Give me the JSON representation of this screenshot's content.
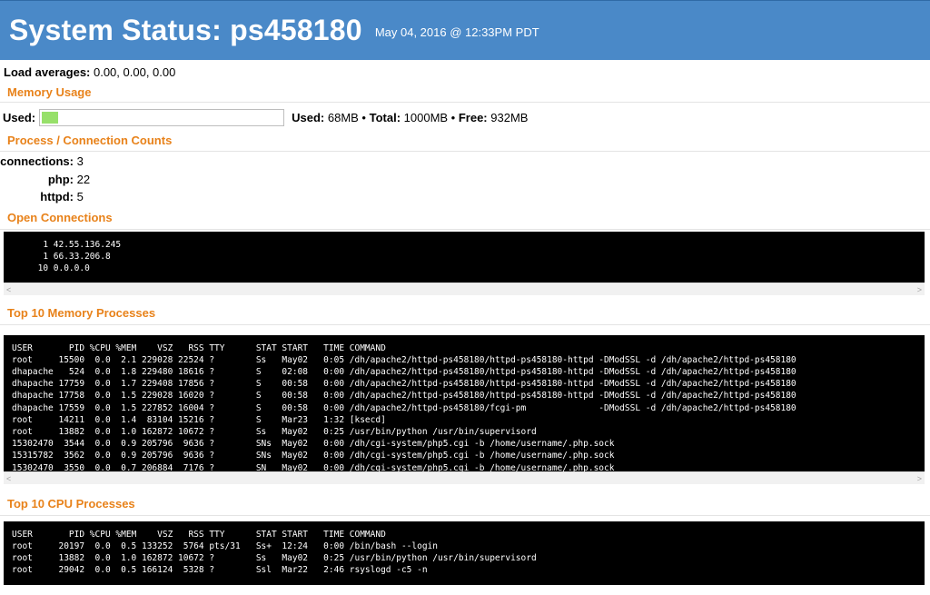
{
  "header": {
    "title": "System Status: ps458180",
    "date": "May 04, 2016 @ 12:33PM PDT"
  },
  "load": {
    "label": "Load averages:",
    "value": " 0.00, 0.00, 0.00"
  },
  "memory": {
    "heading": "Memory Usage",
    "used_label": "Used:",
    "used_fraction": 0.068,
    "summary_used_label": "Used:",
    "summary_used_value": " 68MB • ",
    "summary_total_label": "Total:",
    "summary_total_value": " 1000MB • ",
    "summary_free_label": "Free:",
    "summary_free_value": " 932MB",
    "bar_color": "#97e06a"
  },
  "counts": {
    "heading": "Process / Connection Counts",
    "items": [
      {
        "label": "connections:",
        "value": " 3"
      },
      {
        "label": "php:",
        "value": " 22"
      },
      {
        "label": "httpd:",
        "value": " 5"
      }
    ]
  },
  "connections": {
    "heading": "Open Connections",
    "text": "      1 42.55.136.245\n      1 66.33.206.8\n     10 0.0.0.0"
  },
  "mem_procs": {
    "heading": "Top 10 Memory Processes",
    "text": "USER       PID %CPU %MEM    VSZ   RSS TTY      STAT START   TIME COMMAND\nroot     15500  0.0  2.1 229028 22524 ?        Ss   May02   0:05 /dh/apache2/httpd-ps458180/httpd-ps458180-httpd -DModSSL -d /dh/apache2/httpd-ps458180\ndhapache   524  0.0  1.8 229480 18616 ?        S    02:08   0:00 /dh/apache2/httpd-ps458180/httpd-ps458180-httpd -DModSSL -d /dh/apache2/httpd-ps458180\ndhapache 17759  0.0  1.7 229408 17856 ?        S    00:58   0:00 /dh/apache2/httpd-ps458180/httpd-ps458180-httpd -DModSSL -d /dh/apache2/httpd-ps458180\ndhapache 17758  0.0  1.5 229028 16020 ?        S    00:58   0:00 /dh/apache2/httpd-ps458180/httpd-ps458180-httpd -DModSSL -d /dh/apache2/httpd-ps458180\ndhapache 17559  0.0  1.5 227852 16004 ?        S    00:58   0:00 /dh/apache2/httpd-ps458180/fcgi-pm              -DModSSL -d /dh/apache2/httpd-ps458180\nroot     14211  0.0  1.4  83104 15216 ?        S    Mar23   1:32 [ksecd]\nroot     13882  0.0  1.0 162872 10672 ?        Ss   May02   0:25 /usr/bin/python /usr/bin/supervisord\n15302470  3544  0.0  0.9 205796  9636 ?        SNs  May02   0:00 /dh/cgi-system/php5.cgi -b /home/username/.php.sock\n15315782  3562  0.0  0.9 205796  9636 ?        SNs  May02   0:00 /dh/cgi-system/php5.cgi -b /home/username/.php.sock\n15302470  3550  0.0  0.7 206884  7176 ?        SN   May02   0:00 /dh/cgi-system/php5.cgi -b /home/username/.php.sock"
  },
  "cpu_procs": {
    "heading": "Top 10 CPU Processes",
    "text": "USER       PID %CPU %MEM    VSZ   RSS TTY      STAT START   TIME COMMAND\nroot     20197  0.0  0.5 133252  5764 pts/31   Ss+  12:24   0:00 /bin/bash --login\nroot     13882  0.0  1.0 162872 10672 ?        Ss   May02   0:25 /usr/bin/python /usr/bin/supervisord\nroot     29042  0.0  0.5 166124  5328 ?        Ssl  Mar22   2:46 rsyslogd -c5 -n"
  },
  "scroll": {
    "left_arrow": "<",
    "right_arrow": ">"
  },
  "colors": {
    "header_bg": "#4a89c8",
    "heading": "#e8821a"
  }
}
